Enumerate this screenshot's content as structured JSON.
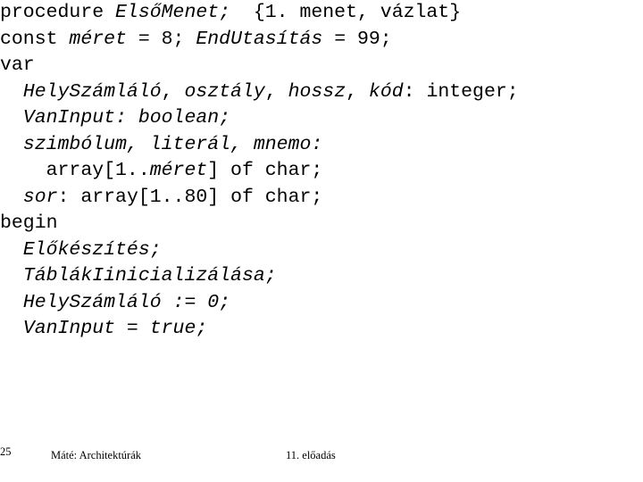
{
  "slide": {
    "title_text": "procedure ElsőMenet;  {1. menet, vázlat}",
    "language": "Pascal"
  },
  "code": {
    "lines": [
      {
        "indent": 0,
        "runs": [
          {
            "style": "roman",
            "text": "procedure "
          },
          {
            "style": "italic",
            "text": "ElsőMenet;"
          },
          {
            "style": "roman",
            "text": "  {1. menet, vázlat}"
          }
        ]
      },
      {
        "indent": 0,
        "runs": [
          {
            "style": "roman",
            "text": "const "
          },
          {
            "style": "italic",
            "text": "méret"
          },
          {
            "style": "roman",
            "text": " = 8; "
          },
          {
            "style": "italic",
            "text": "EndUtasítás"
          },
          {
            "style": "roman",
            "text": " = 99;"
          }
        ]
      },
      {
        "indent": 0,
        "runs": [
          {
            "style": "roman",
            "text": "var"
          }
        ]
      },
      {
        "indent": 2,
        "runs": [
          {
            "style": "italic",
            "text": "HelySzámláló"
          },
          {
            "style": "roman",
            "text": ", "
          },
          {
            "style": "italic",
            "text": "osztály"
          },
          {
            "style": "roman",
            "text": ", "
          },
          {
            "style": "italic",
            "text": "hossz"
          },
          {
            "style": "roman",
            "text": ", "
          },
          {
            "style": "italic",
            "text": "kód"
          },
          {
            "style": "roman",
            "text": ": integer;"
          }
        ]
      },
      {
        "indent": 2,
        "runs": [
          {
            "style": "italic",
            "text": "VanInput: boolean;"
          }
        ]
      },
      {
        "indent": 2,
        "runs": [
          {
            "style": "italic",
            "text": "szimbólum, literál, mnemo:"
          }
        ]
      },
      {
        "indent": 4,
        "runs": [
          {
            "style": "roman",
            "text": "array[1.."
          },
          {
            "style": "italic",
            "text": "méret"
          },
          {
            "style": "roman",
            "text": "] of char;"
          }
        ]
      },
      {
        "indent": 2,
        "runs": [
          {
            "style": "italic",
            "text": "sor"
          },
          {
            "style": "roman",
            "text": ": array[1..80] of char;"
          }
        ]
      },
      {
        "indent": 0,
        "runs": [
          {
            "style": "roman",
            "text": "begin"
          }
        ]
      },
      {
        "indent": 2,
        "runs": [
          {
            "style": "italic",
            "text": "Előkészítés;"
          }
        ]
      },
      {
        "indent": 2,
        "runs": [
          {
            "style": "italic",
            "text": "TáblákIinicializálása;"
          }
        ]
      },
      {
        "indent": 2,
        "runs": [
          {
            "style": "italic",
            "text": "HelySzámláló := 0;"
          }
        ]
      },
      {
        "indent": 2,
        "runs": [
          {
            "style": "italic",
            "text": "VanInput = true;"
          }
        ]
      }
    ]
  },
  "footer": {
    "author": "Máté: Architektúrák",
    "lecture": "11. előadás",
    "page": "25"
  },
  "colors": {
    "background": "#ffffff",
    "text": "#000000"
  }
}
